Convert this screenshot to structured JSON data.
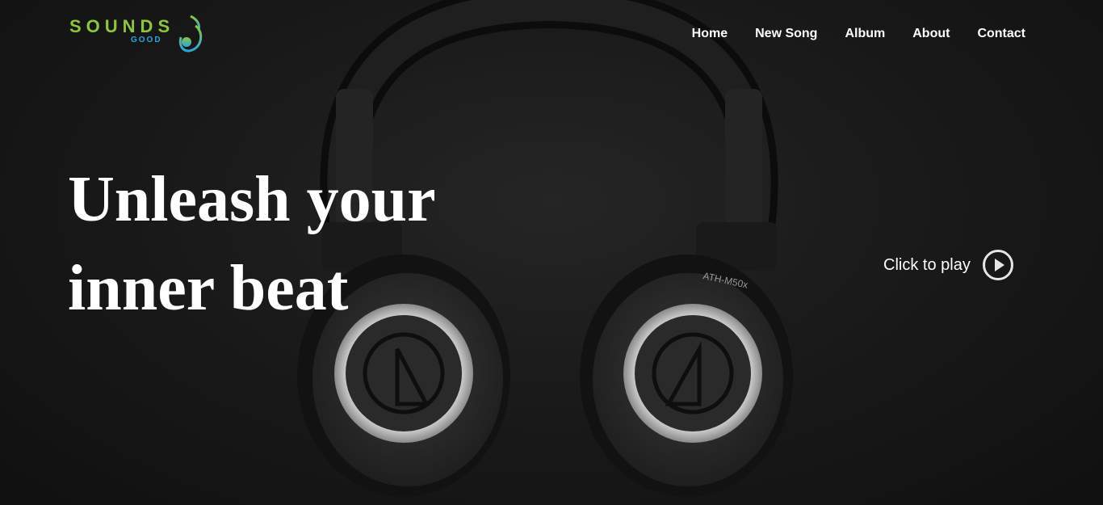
{
  "brand": {
    "name_top": "SOUNDS",
    "name_bottom": "GOOD",
    "colors": {
      "green": "#8cc63f",
      "blue": "#2aa7df"
    },
    "icon": "music-note-icon"
  },
  "nav": {
    "items": [
      {
        "label": "Home"
      },
      {
        "label": "New Song"
      },
      {
        "label": "Album"
      },
      {
        "label": "About"
      },
      {
        "label": "Contact"
      }
    ]
  },
  "hero": {
    "headline_line1": "Unleash your",
    "headline_line2": "inner beat",
    "play_label": "Click to play",
    "play_icon": "play-circle-icon",
    "image": "headphones-photo",
    "headphone_brand_mark": "ATH-M50x"
  }
}
